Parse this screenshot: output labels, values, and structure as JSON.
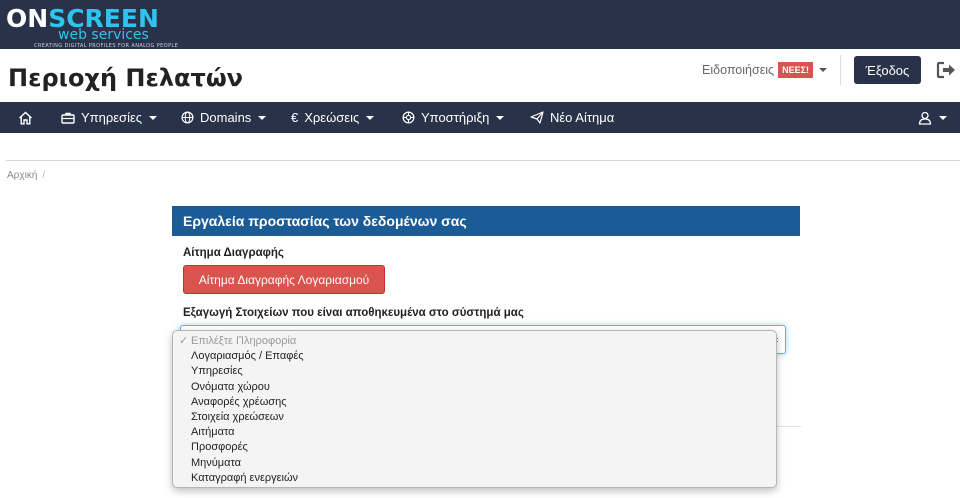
{
  "brand": {
    "logo_part1": "ON",
    "logo_part2": "SCREEN",
    "logo_sub": "web services",
    "logo_tagline": "CREATING DIGITAL PROFILES FOR ANALOG PEOPLE",
    "colors": {
      "dark": "#283248",
      "accent": "#2ec4f0"
    }
  },
  "header": {
    "title": "Περιοχή Πελατών",
    "notifications_label": "Ειδοποιήσεις",
    "notifications_badge": "ΝΕΕΣ!",
    "logout_label": "Έξοδος",
    "logout_icon": "sign-out-icon"
  },
  "nav": {
    "home_icon": "home-icon",
    "items": [
      {
        "label": "Υπηρεσίες",
        "icon": "briefcase-icon"
      },
      {
        "label": "Domains",
        "icon": "globe-icon"
      },
      {
        "label": "Χρεώσεις",
        "icon": "euro-icon"
      },
      {
        "label": "Υποστήριξη",
        "icon": "lifebuoy-icon"
      },
      {
        "label": "Νέο Αίτημα",
        "icon": "paper-plane-icon"
      }
    ],
    "user_icon": "user-icon"
  },
  "breadcrumb": {
    "home": "Αρχική",
    "separator": "/"
  },
  "panel": {
    "title": "Εργαλεία προστασίας των δεδομένων σας",
    "delete_label": "Αίτημα Διαγραφής",
    "delete_button": "Αίτημα Διαγραφής Λογαριασμού",
    "export_label": "Εξαγωγή Στοιχείων που είναι αποθηκευμένα στο σύστημά μας",
    "colors": {
      "header": "#1b5c97",
      "danger": "#d9534f"
    }
  },
  "dropdown": {
    "placeholder": "Επιλέξτε Πληροφορία",
    "check": "✓",
    "options": [
      "Λογαριασμός / Επαφές",
      "Υπηρεσίες",
      "Ονόματα χώρου",
      "Αναφορές χρέωσης",
      "Στοιχεία χρεώσεων",
      "Αιτήματα",
      "Προσφορές",
      "Μηνύματα",
      "Καταγραφή ενεργειών"
    ]
  }
}
